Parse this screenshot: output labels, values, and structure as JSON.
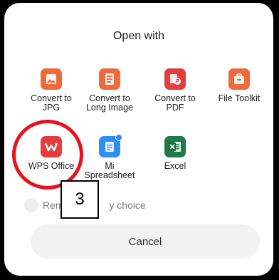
{
  "dialog": {
    "title": "Open with",
    "apps": [
      {
        "line1": "Convert to",
        "line2": "JPG",
        "icon": "image-icon",
        "color": "#ee6a3a"
      },
      {
        "line1": "Convert to",
        "line2": "Long Image",
        "icon": "document-icon",
        "color": "#ee6a3a"
      },
      {
        "line1": "Convert to",
        "line2": "PDF",
        "icon": "pdf-icon",
        "color": "#e43d3d"
      },
      {
        "line1": "File Toolkit",
        "line2": "",
        "icon": "toolbox-icon",
        "color": "#ee6a3a"
      },
      {
        "line1": "WPS Office",
        "line2": "",
        "icon": "wps-office-icon",
        "color": "#e43d3d"
      },
      {
        "line1": "Mi",
        "line2": "Spreadsheet",
        "icon": "spreadsheet-icon",
        "color": "#2f8ff0"
      },
      {
        "line1": "Excel",
        "line2": "",
        "icon": "excel-icon",
        "color": "#1f7a47"
      }
    ],
    "remember_label_start": "Reme",
    "remember_label_end": "y choice",
    "cancel_label": "Cancel"
  },
  "annotation": {
    "step_number": "3",
    "highlight_color": "#e8121c"
  }
}
